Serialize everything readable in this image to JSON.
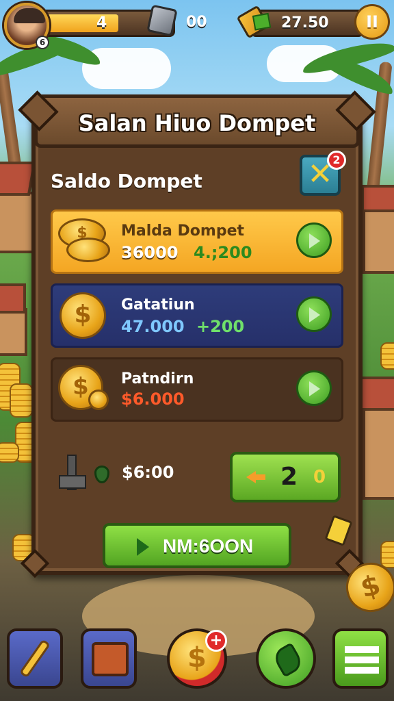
{
  "hud": {
    "level": "4",
    "gems": "00",
    "cash": "27.50",
    "avatar_badge": "6",
    "pause_label": "II",
    "xp_fill_fraction": 0.55
  },
  "panel": {
    "title": "Salan Hiuo Dompet",
    "section_title": "Saldo Dompet",
    "close_label": "✕",
    "close_badge": "2"
  },
  "rows": [
    {
      "label": "Malda Dompet",
      "value": "36000",
      "delta": "4.;200",
      "label_color": "#5a3a10",
      "delta_color": "#2c8a1e",
      "value_color": "#ffffff"
    },
    {
      "label": "Gatatiun",
      "value": "47.000",
      "delta": "+200",
      "label_color": "#ffffff",
      "delta_color": "#6fe06a",
      "value_color": "#7fc8ff"
    },
    {
      "label": "Patndirn",
      "value": "$6.000",
      "delta": "",
      "label_color": "#ffffff",
      "delta_color": "#ffffff",
      "value_color": "#ff5a2a"
    }
  ],
  "footer": {
    "amount": "$6:00",
    "counter_value": "2",
    "counter_small": "0",
    "cta_label": "NM:6OON"
  },
  "bottom_nav": {
    "coin_badge": "+"
  },
  "colors": {
    "gold": "#f4a623",
    "blue_row": "#26306a",
    "dark_row": "#4a3220",
    "green_button": "#5ba823",
    "panel_wood": "#5e3f26"
  }
}
